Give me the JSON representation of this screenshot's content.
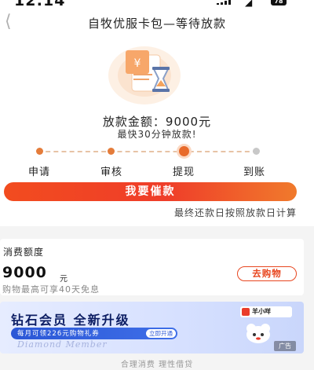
{
  "status_bar": {
    "time": "12:14",
    "battery": "78"
  },
  "nav": {
    "title": "自牧优服卡包—等待放款",
    "back_icon": "chevron-left-icon"
  },
  "loan": {
    "amount_label": "放款金额：",
    "amount_value": "9000元",
    "eta": "最快30分钟放款!",
    "steps": [
      "申请",
      "审核",
      "提现",
      "到账"
    ],
    "current_step_index": 2,
    "cta_label": "我要催款",
    "note": "最终还款日按照放款日计算"
  },
  "credit": {
    "title": "消费额度",
    "amount": "9000",
    "unit": "元",
    "subtext": "购物最高可享40天免息",
    "shop_label": "去购物"
  },
  "banner": {
    "headline": "钻石会员  全新升级",
    "pill_text": "每月可领226元购物礼券",
    "pill_button": "立即开通",
    "script_text": "Diamond Member",
    "brand_name": "羊小咩",
    "ad_label": "广告"
  },
  "footer": {
    "text": "合理消费 理性借贷"
  },
  "colors": {
    "accent": "#ef3d29",
    "step_done": "#e47c3a",
    "step_todo": "#c8c8c8",
    "banner_text": "#0c1d63"
  }
}
